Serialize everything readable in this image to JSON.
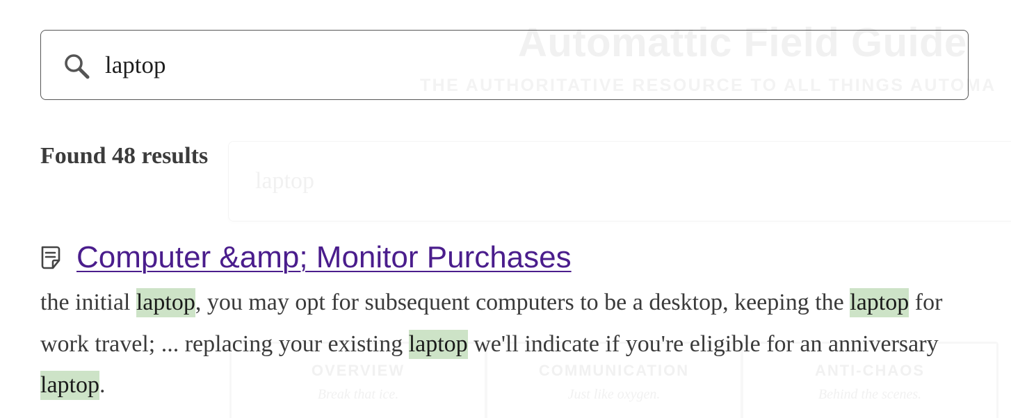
{
  "background": {
    "title": "Automattic Field Guide",
    "subtitle": "THE AUTHORITATIVE RESOURCE TO ALL THINGS AUTOMA",
    "search_text": "laptop",
    "cards": [
      {
        "title": "OVERVIEW",
        "subtitle": "Break that ice."
      },
      {
        "title": "COMMUNICATION",
        "subtitle": "Just like oxygen."
      },
      {
        "title": "ANTI-CHAOS",
        "subtitle": "Behind the scenes."
      }
    ]
  },
  "search": {
    "icon": "search-icon",
    "value": "laptop"
  },
  "results": {
    "count_text": "Found 48 results",
    "items": [
      {
        "icon": "document-icon",
        "title": "Computer &amp; Monitor Purchases",
        "excerpt": {
          "s1": "the initial ",
          "h1": "laptop",
          "s2": ", you may opt for subsequent computers to be a desktop, keeping the ",
          "h2": "laptop",
          "s3": " for work travel; ... replacing your existing ",
          "h3": "laptop",
          "s4": " we'll indicate if you're eligible for an anniversary ",
          "h4": "laptop",
          "s5": "."
        }
      }
    ]
  },
  "colors": {
    "link": "#4a1d8c",
    "highlight": "#cde3c7",
    "border": "#555555"
  }
}
